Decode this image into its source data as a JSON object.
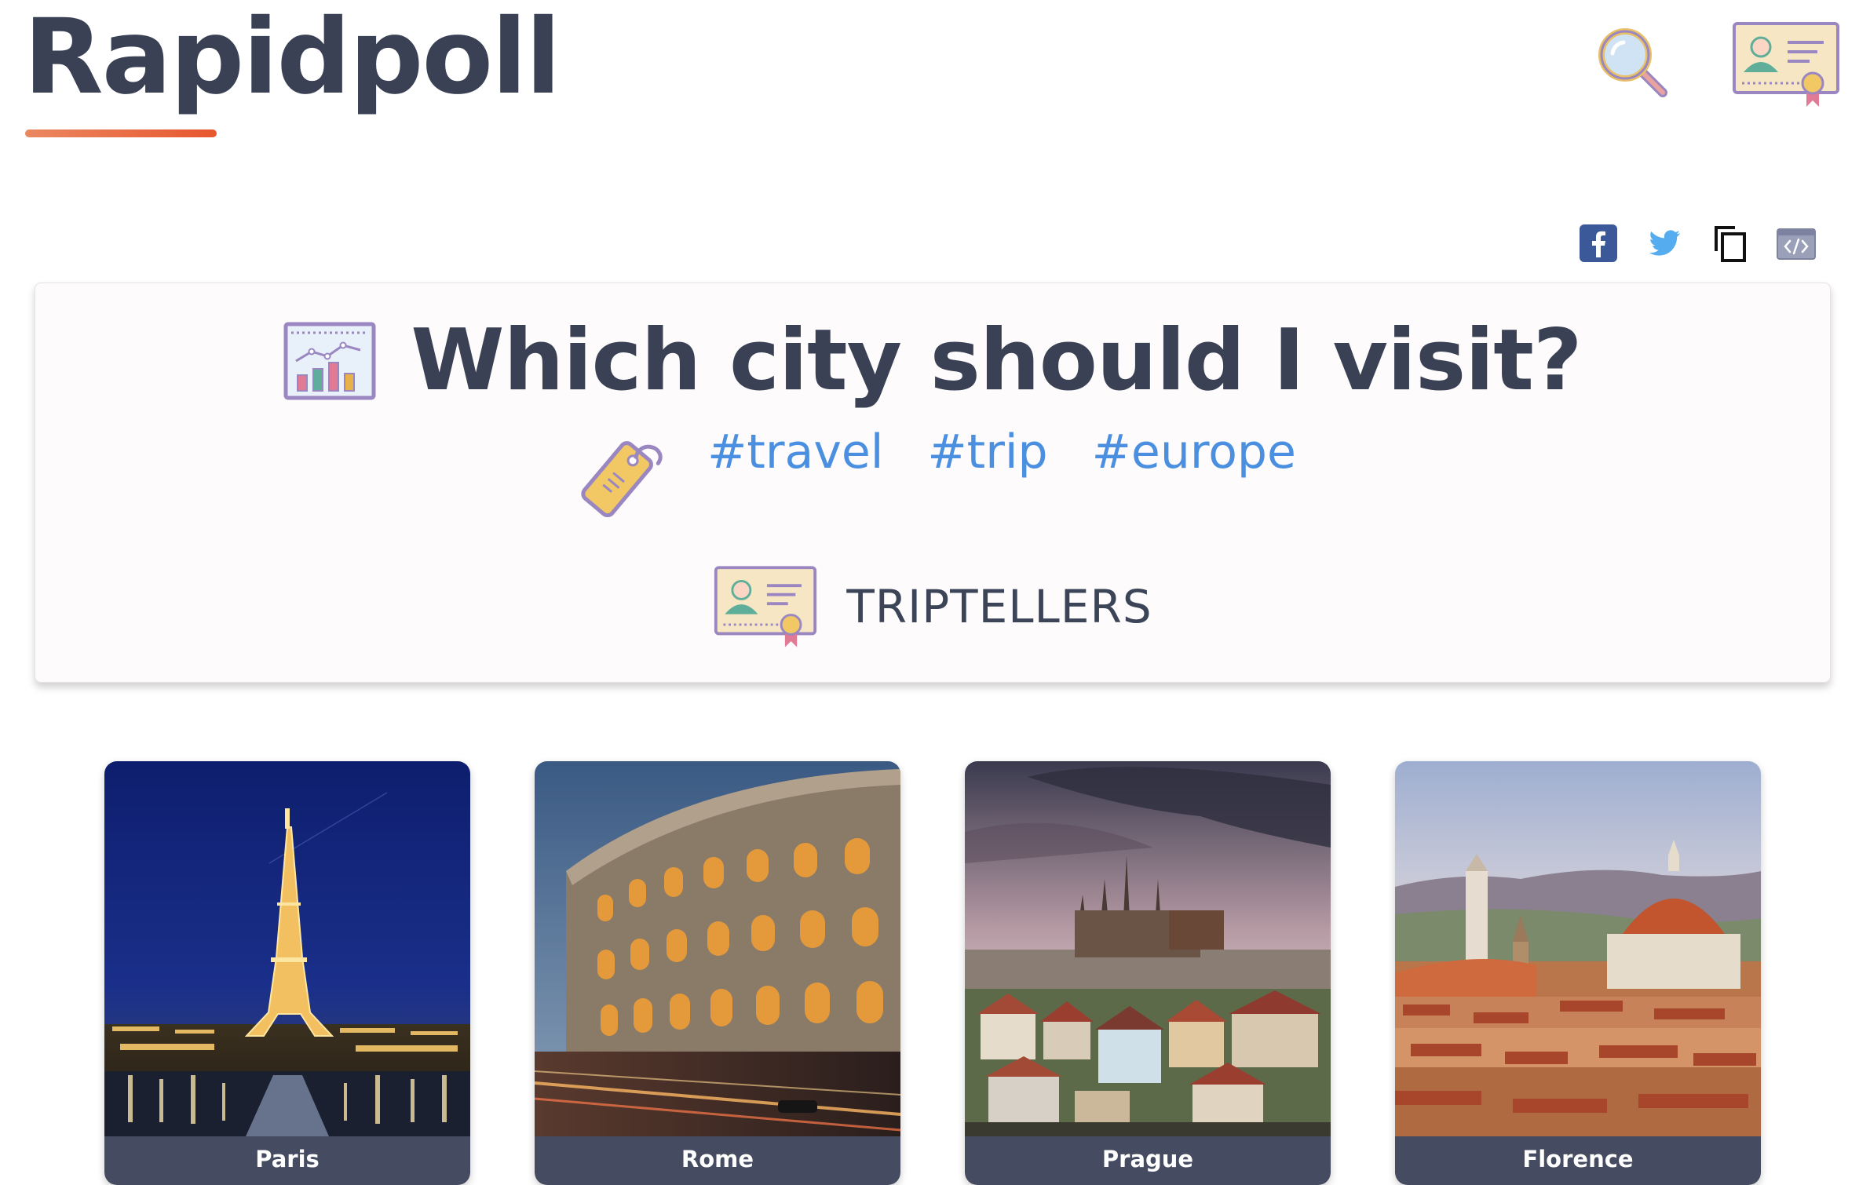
{
  "header": {
    "logo_text": "Rapidpoll",
    "search_icon": "magnifier-icon",
    "profile_icon": "user-badge-certificate-icon"
  },
  "share": {
    "icons": [
      "facebook-icon",
      "twitter-icon",
      "copy-icon",
      "embed-code-icon"
    ]
  },
  "poll": {
    "question": "Which city should I visit?",
    "question_icon": "poll-chart-icon",
    "tag_icon": "tag-label-icon",
    "tags": [
      "#travel",
      "#trip",
      "#europe"
    ],
    "author": "TRIPTELLERS",
    "author_icon": "user-badge-certificate-icon",
    "options": [
      {
        "label": "Paris",
        "photo": "eiffel-tower-night-photo"
      },
      {
        "label": "Rome",
        "photo": "colosseum-dusk-photo"
      },
      {
        "label": "Prague",
        "photo": "prague-castle-photo"
      },
      {
        "label": "Florence",
        "photo": "florence-duomo-photo"
      }
    ]
  },
  "colors": {
    "text_dark": "#3a4154",
    "accent_underline": "#e8562f",
    "tag_link": "#4a8fe0",
    "label_bar": "#454b60",
    "card_bg": "#fdfbfb"
  }
}
